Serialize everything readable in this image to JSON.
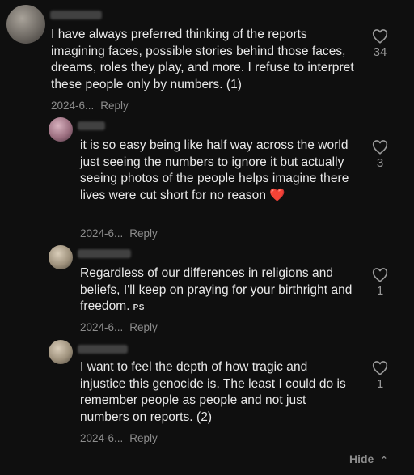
{
  "comments": [
    {
      "text": "I have always preferred thinking of the reports imagining faces, possible stories behind those faces, dreams, roles they play, and more. I refuse to interpret these people only by numbers. (1)",
      "date": "2024-6...",
      "reply": "Reply",
      "likes": "34",
      "heart_icon": "heart-outline-icon"
    },
    {
      "text": "it is so easy being like half way across the world just seeing the numbers to ignore it but actually seeing photos of the people helps imagine there lives were cut short for no reason",
      "emoji": "❤️",
      "date": "2024-6...",
      "reply": "Reply",
      "likes": "3",
      "heart_icon": "heart-outline-icon"
    },
    {
      "text": "Regardless of our differences in religions and beliefs, I'll keep on praying for your birthright and freedom.",
      "tag": "PS",
      "date": "2024-6...",
      "reply": "Reply",
      "likes": "1",
      "heart_icon": "heart-outline-icon"
    },
    {
      "text": "I want to feel the depth of how tragic and injustice this genocide is. The least I could do is remember people as people and not just numbers on reports. (2)",
      "date": "2024-6...",
      "reply": "Reply",
      "likes": "1",
      "heart_icon": "heart-outline-icon"
    }
  ],
  "footer": {
    "hide_label": "Hide",
    "chevron_icon": "chevron-up-icon"
  },
  "colors": {
    "background": "#0f0f0f",
    "text": "#e9e9e9",
    "muted": "#8c8c8c",
    "heart_emoji": "#e53935"
  }
}
